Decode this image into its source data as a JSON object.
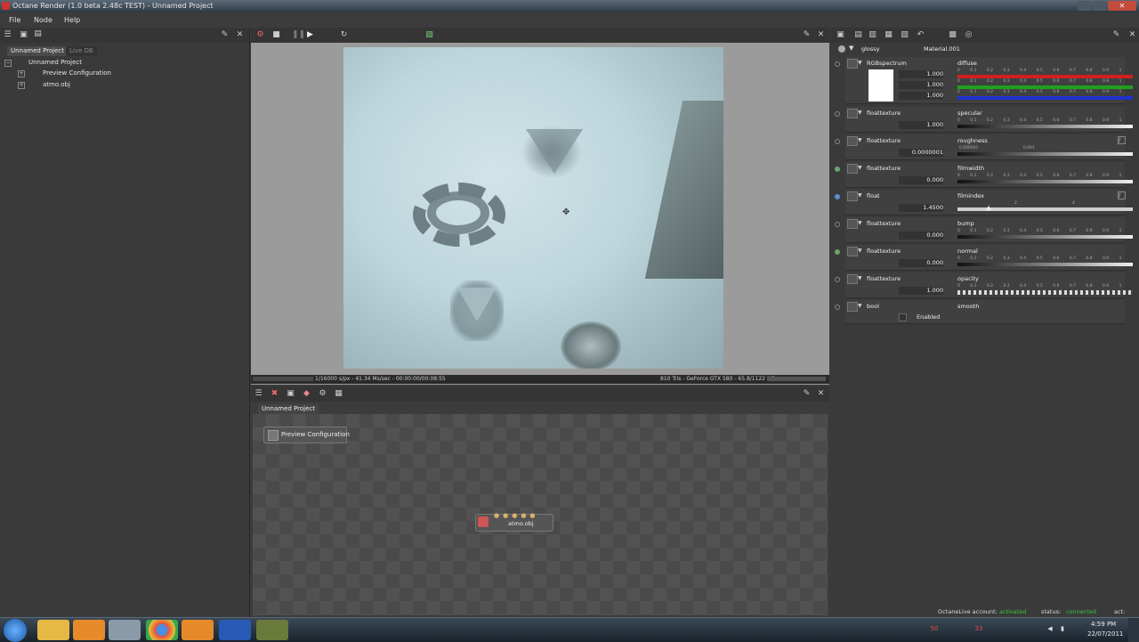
{
  "window": {
    "title": "Octane Render (1.0 beta 2.48c TEST) - Unnamed Project"
  },
  "menu": {
    "items": [
      "File",
      "Node",
      "Help"
    ]
  },
  "left_panel": {
    "tabs": [
      "Unnamed Project",
      "Live DB"
    ],
    "tree": {
      "root": "Unnamed Project",
      "children": [
        "Preview Configuration",
        "atmo.obj"
      ]
    }
  },
  "viewport": {
    "status_left": "1/16000 s/px - 41.34 Ms/sec - 00:00:00/00:08:55",
    "status_right": "810 Tris - GeForce GTX 580 - 65.8/1122 MB"
  },
  "node_graph": {
    "tab": "Unnamed Project",
    "nodes": {
      "preview": "Preview Configuration",
      "mesh": "atmo.obj"
    }
  },
  "material": {
    "type": "glossy",
    "name": "Material.001",
    "params": [
      {
        "type": "RGBspectrum",
        "name": "diffuse",
        "values": [
          "1.000",
          "1.000",
          "1.000"
        ]
      },
      {
        "type": "floattexture",
        "name": "specular",
        "value": "1.000"
      },
      {
        "type": "floattexture",
        "name": "roughness",
        "value": "0.0000001"
      },
      {
        "type": "floattexture",
        "name": "filmwidth",
        "value": "0.000"
      },
      {
        "type": "float",
        "name": "filmindex",
        "value": "1.4500"
      },
      {
        "type": "floattexture",
        "name": "bump",
        "value": "0.000"
      },
      {
        "type": "floattexture",
        "name": "normal",
        "value": "0.000"
      },
      {
        "type": "floattexture",
        "name": "opacity",
        "value": "1.000"
      },
      {
        "type": "bool",
        "name": "smooth",
        "value": "Enabled"
      }
    ],
    "tick_labels": "0 0.1 0.2 0.3 0.4 0.5 0.6 0.7 0.8 0.9 1",
    "roughness_ticks": [
      "0.000001",
      "0.001"
    ],
    "filmindex_ticks": [
      "2",
      "4"
    ]
  },
  "live_status": {
    "account_label": "OctaneLive account:",
    "account_value": "activated",
    "status_label": "status:",
    "status_value": "connected",
    "act_label": "act:"
  },
  "taskbar": {
    "time": "4:59 PM",
    "date": "22/07/2011",
    "tray_numbers": [
      "50",
      "33"
    ]
  },
  "colors": {
    "accent_red": "#d02020",
    "accent_green": "#20a020",
    "accent_blue": "#2030d0",
    "status_green": "#39c639"
  }
}
